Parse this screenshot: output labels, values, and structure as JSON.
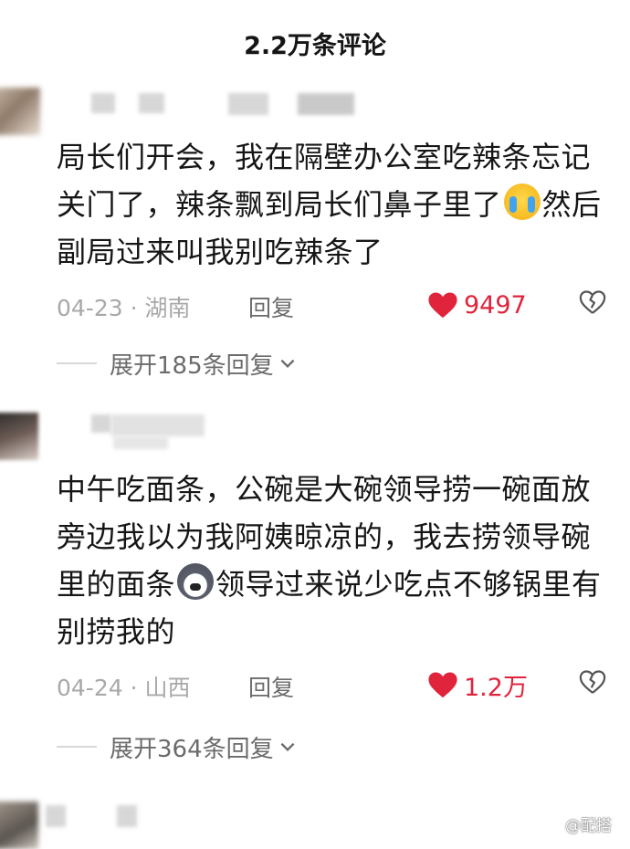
{
  "header": {
    "title": "2.2万条评论"
  },
  "comments": [
    {
      "text_a": "局长们开会，我在隔壁办公室吃辣条忘记关门了，辣条飘到局长们鼻子里了",
      "emoji": "loudly-crying-face",
      "text_b": "然后副局过来叫我别吃辣条了",
      "date_location": "04-23 · 湖南",
      "reply_label": "回复",
      "likes": "9497",
      "expand_label": "展开185条回复"
    },
    {
      "text_a": "中午吃面条，公碗是大碗领导捞一碗面放旁边我以为我阿姨晾凉的，我去捞领导碗里的面条",
      "emoji": "husky-dog-face",
      "text_b": "领导过来说少吃点不够锅里有别捞我的",
      "date_location": "04-24 · 山西",
      "reply_label": "回复",
      "likes": "1.2万",
      "expand_label": "展开364条回复"
    }
  ],
  "watermark": {
    "text": "@配搭"
  },
  "colors": {
    "like_red": "#e0243c",
    "meta_gray": "#a8a8a8"
  }
}
